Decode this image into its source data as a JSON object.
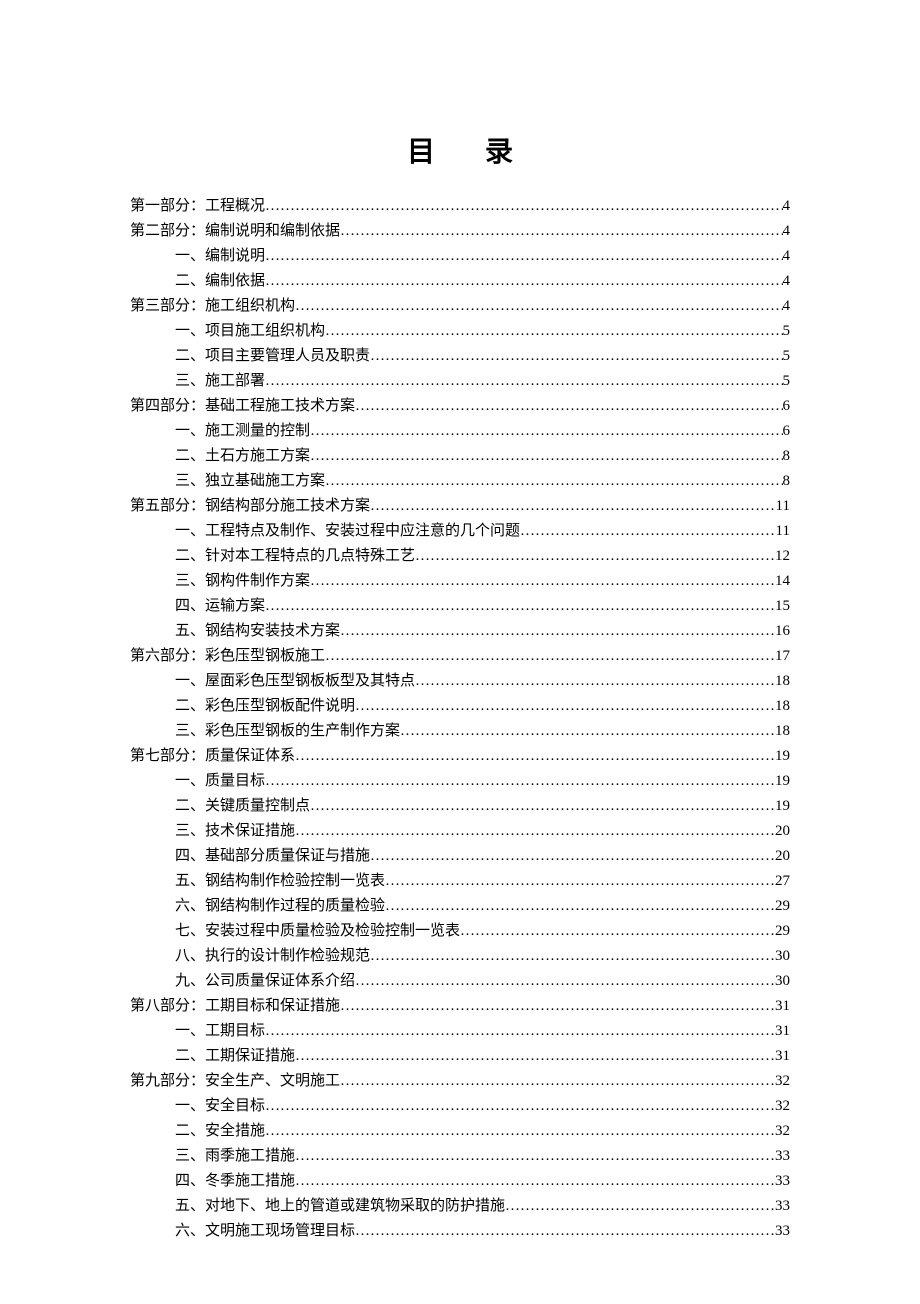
{
  "title": "目录",
  "entries": [
    {
      "level": 0,
      "label": "第一部分：工程概况",
      "page": "4"
    },
    {
      "level": 0,
      "label": "第二部分：编制说明和编制依据",
      "page": "4"
    },
    {
      "level": 1,
      "label": "一、编制说明",
      "page": "4"
    },
    {
      "level": 1,
      "label": "二、编制依据",
      "page": "4"
    },
    {
      "level": 0,
      "label": "第三部分：施工组织机构",
      "page": "4"
    },
    {
      "level": 1,
      "label": "一、项目施工组织机构",
      "page": "5"
    },
    {
      "level": 1,
      "label": "二、项目主要管理人员及职责 ",
      "page": "5"
    },
    {
      "level": 1,
      "label": "三、施工部署",
      "page": "5"
    },
    {
      "level": 0,
      "label": "第四部分：基础工程施工技术方案",
      "page": "6"
    },
    {
      "level": 1,
      "label": "一、施工测量的控制",
      "page": "6"
    },
    {
      "level": 1,
      "label": "二、土石方施工方案",
      "page": "8"
    },
    {
      "level": 1,
      "label": "三、独立基础施工方案",
      "page": "8"
    },
    {
      "level": 0,
      "label": "第五部分：钢结构部分施工技术方案",
      "page": "11"
    },
    {
      "level": 1,
      "label": "一、工程特点及制作、安装过程中应注意的几个问题",
      "page": "11"
    },
    {
      "level": 1,
      "label": "二、针对本工程特点的几点特殊工艺",
      "page": "12"
    },
    {
      "level": 1,
      "label": "三、钢构件制作方案",
      "page": "14"
    },
    {
      "level": 1,
      "label": "四、运输方案",
      "page": "15"
    },
    {
      "level": 1,
      "label": "五、钢结构安装技术方案",
      "page": "16"
    },
    {
      "level": 0,
      "label": "第六部分：彩色压型钢板施工",
      "page": "17"
    },
    {
      "level": 1,
      "label": "一、屋面彩色压型钢板板型及其特点",
      "page": "18"
    },
    {
      "level": 1,
      "label": "二、彩色压型钢板配件说明",
      "page": "18"
    },
    {
      "level": 1,
      "label": "三、彩色压型钢板的生产制作方案",
      "page": "18"
    },
    {
      "level": 0,
      "label": "第七部分：质量保证体系",
      "page": "19"
    },
    {
      "level": 1,
      "label": "一、质量目标",
      "page": "19"
    },
    {
      "level": 1,
      "label": "二、关键质量控制点",
      "page": "19"
    },
    {
      "level": 1,
      "label": "三、技术保证措施",
      "page": "20"
    },
    {
      "level": 1,
      "label": "四、基础部分质量保证与措施",
      "page": "20"
    },
    {
      "level": 1,
      "label": "五、钢结构制作检验控制一览表",
      "page": "27"
    },
    {
      "level": 1,
      "label": "六、钢结构制作过程的质量检验",
      "page": "29"
    },
    {
      "level": 1,
      "label": "七、安装过程中质量检验及检验控制一览表",
      "page": "29"
    },
    {
      "level": 1,
      "label": "八、执行的设计制作检验规范",
      "page": "30"
    },
    {
      "level": 1,
      "label": "九、公司质量保证体系介绍",
      "page": "30"
    },
    {
      "level": 0,
      "label": "第八部分：工期目标和保证措施",
      "page": "31"
    },
    {
      "level": 1,
      "label": "一、工期目标",
      "page": "31"
    },
    {
      "level": 1,
      "label": "二、工期保证措施",
      "page": "31"
    },
    {
      "level": 0,
      "label": "第九部分：安全生产、文明施工",
      "page": "32"
    },
    {
      "level": 1,
      "label": "一、安全目标",
      "page": "32"
    },
    {
      "level": 1,
      "label": "二、安全措施",
      "page": "32"
    },
    {
      "level": 1,
      "label": "三、雨季施工措施",
      "page": "33"
    },
    {
      "level": 1,
      "label": "四、冬季施工措施",
      "page": "33"
    },
    {
      "level": 1,
      "label": "五、对地下、地上的管道或建筑物采取的防护措施",
      "page": "33"
    },
    {
      "level": 1,
      "label": "六、文明施工现场管理目标",
      "page": "33"
    }
  ]
}
